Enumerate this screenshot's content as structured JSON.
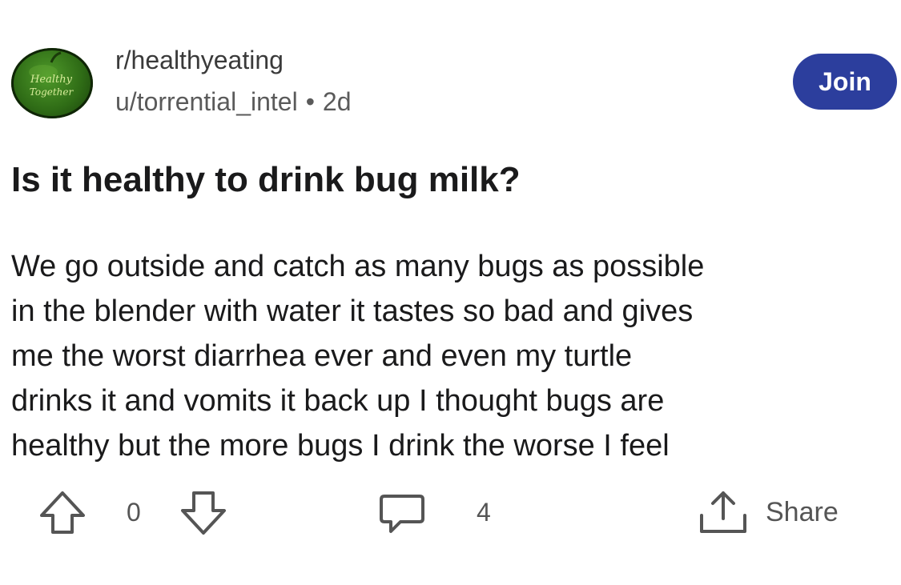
{
  "community": {
    "name": "r/healthyeating",
    "avatar_text": [
      "Healthy",
      "Together"
    ],
    "avatar_color": "#2f6c16"
  },
  "author": {
    "username": "u/torrential_intel",
    "separator": "•",
    "age": "2d"
  },
  "join_button": {
    "label": "Join",
    "color": "#2c3e9d"
  },
  "post": {
    "title": "Is it healthy to drink bug milk?",
    "body_lines": [
      "We go outside and catch as many bugs as possible",
      "in the blender with water it tastes so bad and gives",
      "me the worst diarrhea ever and even my turtle",
      "drinks it and vomits it back up I thought bugs are",
      "healthy but the more bugs I drink the worse I feel"
    ]
  },
  "actions": {
    "vote_count": "0",
    "comment_count": "4",
    "share_label": "Share",
    "icons": [
      "upvote-arrow-icon",
      "downvote-arrow-icon",
      "comment-bubble-icon",
      "share-upload-icon"
    ]
  }
}
